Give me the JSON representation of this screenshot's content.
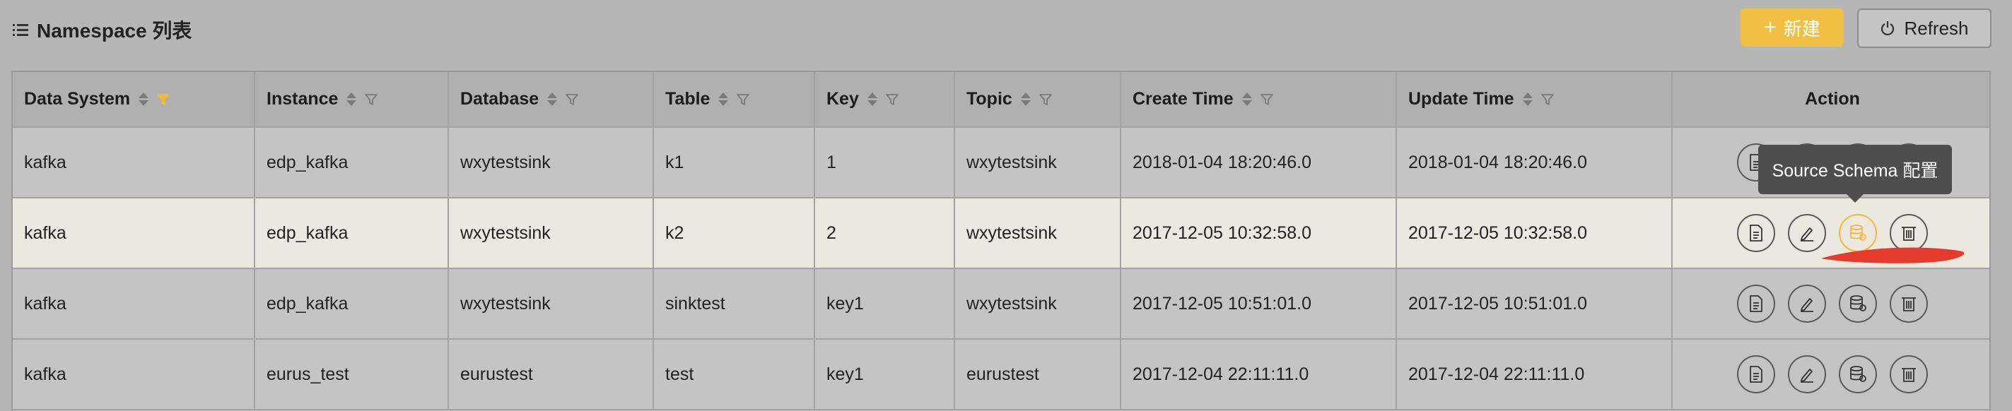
{
  "header": {
    "title": "Namespace 列表",
    "new_button": "新建",
    "new_icon": "plus-icon",
    "refresh_button": "Refresh",
    "refresh_icon": "power-icon"
  },
  "colors": {
    "accent": "#f2bf45",
    "filter_active": "#f0b93a",
    "tooltip_bg": "#4e4e4e",
    "highlight_row": "#ebe8df",
    "annotation_red": "#e53b2c"
  },
  "table": {
    "columns": [
      "Data System",
      "Instance",
      "Database",
      "Table",
      "Key",
      "Topic",
      "Create Time",
      "Update Time",
      "Action"
    ],
    "active_filter_column": "Data System",
    "rows": [
      [
        "kafka",
        "edp_kafka",
        "wxytestsink",
        "k1",
        "1",
        "wxytestsink",
        "2018-01-04 18:20:46.0",
        "2018-01-04 18:20:46.0"
      ],
      [
        "kafka",
        "edp_kafka",
        "wxytestsink",
        "k2",
        "2",
        "wxytestsink",
        "2017-12-05 10:32:58.0",
        "2017-12-05 10:32:58.0"
      ],
      [
        "kafka",
        "edp_kafka",
        "wxytestsink",
        "sinktest",
        "key1",
        "wxytestsink",
        "2017-12-05 10:51:01.0",
        "2017-12-05 10:51:01.0"
      ],
      [
        "kafka",
        "eurus_test",
        "eurustest",
        "test",
        "key1",
        "eurustest",
        "2017-12-04 22:11:11.0",
        "2017-12-04 22:11:11.0"
      ]
    ],
    "action_icons": [
      "document-icon",
      "edit-icon",
      "database-schema-icon",
      "delete-icon"
    ]
  },
  "tooltip": {
    "text": "Source Schema 配置"
  }
}
